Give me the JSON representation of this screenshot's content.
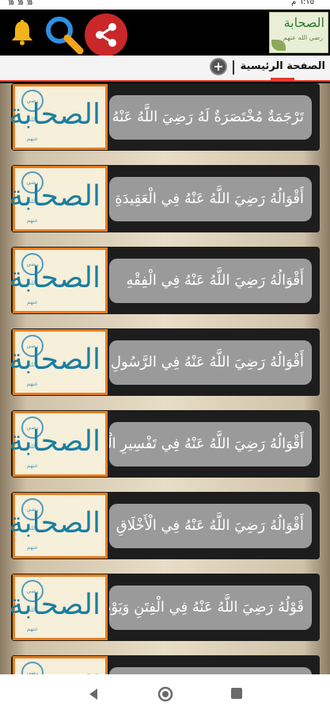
{
  "status_bar": {
    "left_text": "᯾ ᯾ ᯾",
    "right_text": "٦:١٥ م"
  },
  "top_bar": {
    "icons": [
      "bell-icon",
      "search-icon",
      "share-icon"
    ],
    "logo_title": "الصحابة",
    "logo_subtitle": "رضي الله عنهم"
  },
  "tabs": {
    "active_label": "الصفحة الرئيسية"
  },
  "list": {
    "thumb_text": "الصحابة",
    "badge_text": "رضي الله عنهم",
    "items": [
      {
        "label": "تَرْجَمَةٌ مُخْتَصَرَةٌ لَهُ رَضِيَ اللَّهُ عَنْهُ"
      },
      {
        "label": "أَقْوَالُهُ رَضِيَ اللَّهُ عَنْهُ فِي الْعَقِيدَةِ"
      },
      {
        "label": "أَقْوَالُهُ رَضِيَ اللَّهُ عَنْهُ فِي الْفِقْهِ"
      },
      {
        "label": "أَقْوَالُهُ رَضِيَ اللَّهُ عَنْهُ فِي الرَّسُولِ"
      },
      {
        "label": "أَقْوَالُهُ رَضِيَ اللَّهُ عَنْهُ فِي تَفْسِيرِ الْقُرْآنِ"
      },
      {
        "label": "أَقْوَالُهُ رَضِيَ اللَّهُ عَنْهُ فِي الْأَخْلَاقِ"
      },
      {
        "label": "قَوْلُهُ رَضِيَ اللَّهُ عَنْهُ فِي الْفِتَنِ وَيَوْمِ الْقِيَامَةِ"
      },
      {
        "label": ""
      }
    ]
  },
  "colors": {
    "accent": "#e23b2f",
    "share_bg": "#c9272a",
    "thumb_border": "#e77d1e"
  }
}
